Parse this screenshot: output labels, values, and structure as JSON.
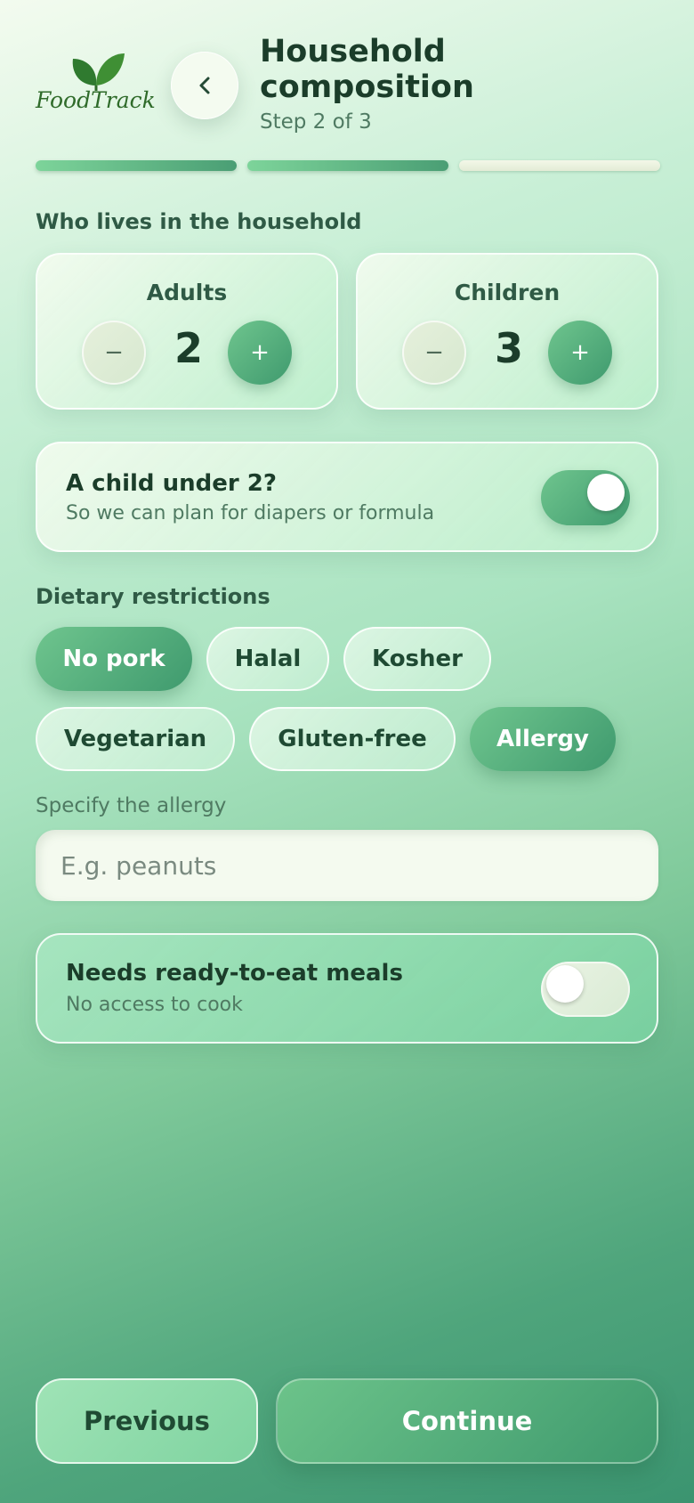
{
  "app": {
    "logo_text": "FoodTrack"
  },
  "header": {
    "title": "Household composition",
    "step": "Step 2 of 3"
  },
  "progress": {
    "current_step": 2,
    "total_steps": 3
  },
  "household": {
    "section_label": "Who lives in the household",
    "adults": {
      "label": "Adults",
      "value": "2",
      "minus": "−",
      "plus": "+"
    },
    "children": {
      "label": "Children",
      "value": "3",
      "minus": "−",
      "plus": "+"
    }
  },
  "under_two": {
    "title": "A child under 2?",
    "subtitle": "So we can plan for diapers or formula",
    "enabled": true
  },
  "dietary": {
    "section_label": "Dietary restrictions",
    "chips": [
      {
        "label": "No pork",
        "selected": true
      },
      {
        "label": "Halal",
        "selected": false
      },
      {
        "label": "Kosher",
        "selected": false
      },
      {
        "label": "Vegetarian",
        "selected": false
      },
      {
        "label": "Gluten-free",
        "selected": false
      },
      {
        "label": "Allergy",
        "selected": true
      }
    ]
  },
  "allergy": {
    "label": "Specify the allergy",
    "placeholder": "E.g. peanuts",
    "value": ""
  },
  "ready_meals": {
    "title": "Needs ready-to-eat meals",
    "subtitle": "No access to cook",
    "enabled": false
  },
  "footer": {
    "previous": "Previous",
    "continue": "Continue"
  },
  "colors": {
    "accent": "#4a9e74",
    "text_dark": "#1b3d2a",
    "text_muted": "#4f7a62"
  }
}
